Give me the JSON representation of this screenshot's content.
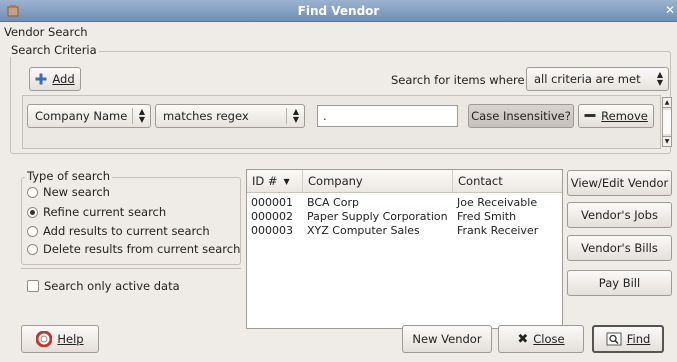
{
  "window": {
    "title": "Find Vendor"
  },
  "header": {
    "label": "Vendor Search"
  },
  "criteria": {
    "frame_title": "Search Criteria",
    "add_label": "Add",
    "search_for_label": "Search for items where",
    "match_mode": "all criteria are met",
    "row": {
      "field": "Company Name",
      "operator": "matches regex",
      "value": ".",
      "case_label": "Case Insensitive?",
      "remove_label": "Remove"
    }
  },
  "search_type": {
    "title": "Type of search",
    "options": [
      {
        "label": "New search",
        "selected": false
      },
      {
        "label": "Refine current search",
        "selected": true
      },
      {
        "label": "Add results to current search",
        "selected": false
      },
      {
        "label": "Delete results from current search",
        "selected": false
      }
    ],
    "active_only_label": "Search only active data"
  },
  "results": {
    "columns": [
      "ID #",
      "Company",
      "Contact"
    ],
    "rows": [
      {
        "id": "000001",
        "company": "BCA Corp",
        "contact": "Joe Receivable"
      },
      {
        "id": "000002",
        "company": "Paper Supply Corporation",
        "contact": "Fred Smith"
      },
      {
        "id": "000003",
        "company": "XYZ Computer Sales",
        "contact": "Frank Receiver"
      }
    ]
  },
  "side_buttons": {
    "view_edit": "View/Edit Vendor",
    "jobs": "Vendor's Jobs",
    "bills": "Vendor's Bills",
    "pay": "Pay Bill"
  },
  "footer": {
    "help": "Help",
    "new_vendor": "New Vendor",
    "close": "Close",
    "find": "Find"
  },
  "colors": {
    "titlebar": "#7e9cc2",
    "window_bg": "#efebe7"
  }
}
